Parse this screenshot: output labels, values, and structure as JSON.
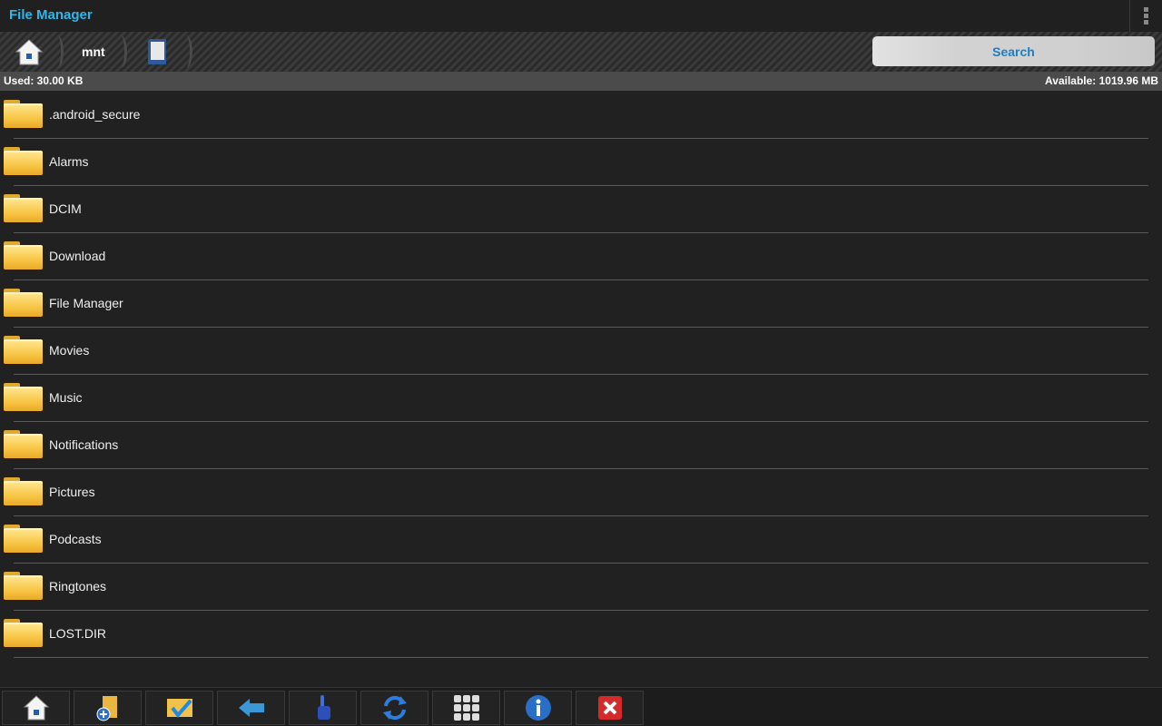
{
  "app": {
    "title": "File Manager"
  },
  "breadcrumb": {
    "items": [
      {
        "icon": "home-icon"
      },
      {
        "label": "mnt"
      },
      {
        "icon": "sdcard-icon"
      }
    ]
  },
  "search": {
    "label": "Search"
  },
  "status": {
    "used": "Used: 30.00 KB",
    "available": "Available: 1019.96 MB"
  },
  "files": [
    ".android_secure",
    "Alarms",
    "DCIM",
    "Download",
    "File Manager",
    "Movies",
    "Music",
    "Notifications",
    "Pictures",
    "Podcasts",
    "Ringtones",
    "LOST.DIR"
  ],
  "toolbar": [
    "home-icon",
    "new-folder-icon",
    "multi-select-icon",
    "back-icon",
    "hand-pointer-icon",
    "refresh-icon",
    "grid-view-icon",
    "info-icon",
    "close-icon"
  ],
  "colors": {
    "accent": "#33b5e5",
    "search_text": "#1a7fc4"
  }
}
